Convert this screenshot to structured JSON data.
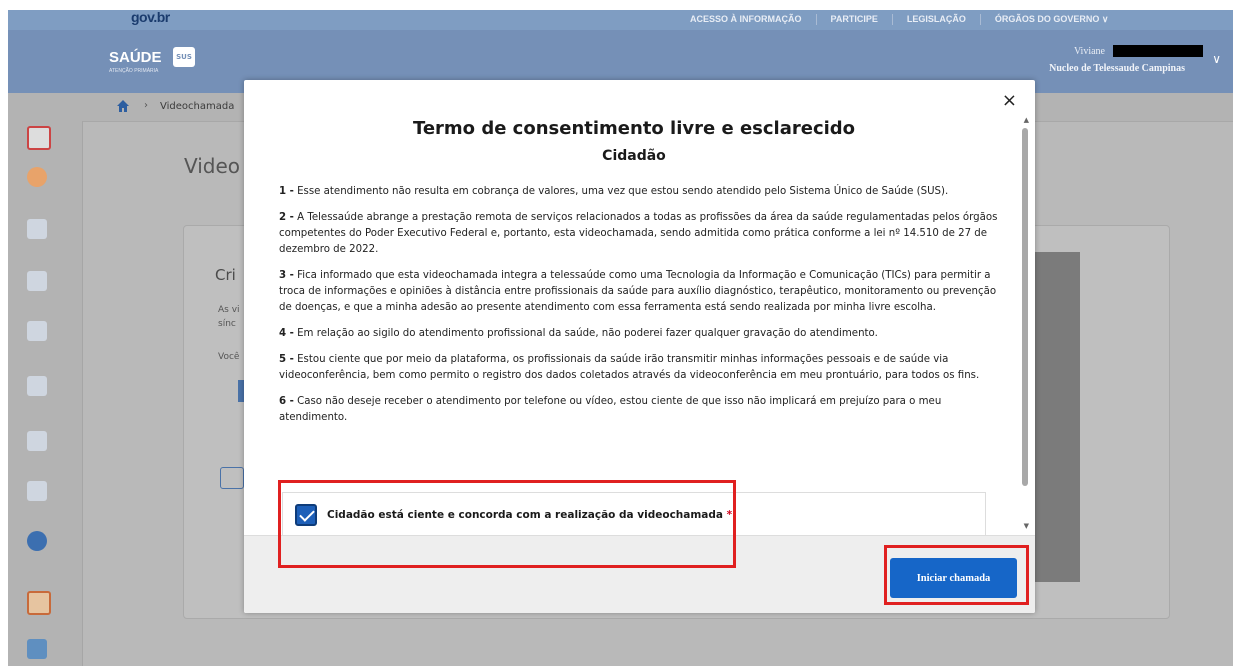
{
  "gov": {
    "logo": "gov.br",
    "links": [
      "ACESSO À INFORMAÇÃO",
      "PARTICIPE",
      "LEGISLAÇÃO",
      "ÓRGÃOS DO GOVERNO"
    ]
  },
  "app": {
    "logo": "SAÚDE",
    "logo_sub": "ATENÇÃO PRIMÁRIA",
    "logo_badge": "SUS",
    "user_name": "Viviane",
    "user_org": "Nucleo de Telessaude Campinas"
  },
  "breadcrumb": {
    "current": "Videochamada"
  },
  "background": {
    "title": "Video",
    "card_heading": "Cri",
    "card_text1": "As vi",
    "card_text2": "sínc",
    "card_text3": "Você"
  },
  "modal": {
    "title": "Termo de consentimento livre e esclarecido",
    "subtitle": "Cidadão",
    "items": [
      {
        "num": "1 -",
        "text": "Esse atendimento não resulta em cobrança de valores, uma vez que estou sendo atendido pelo Sistema Único de Saúde (SUS)."
      },
      {
        "num": "2 -",
        "text": "A Telessaúde abrange a prestação remota de serviços relacionados a todas as profissões da área da saúde regulamentadas pelos órgãos competentes do Poder Executivo Federal e, portanto, esta videochamada, sendo admitida como prática conforme a lei nº 14.510 de 27 de dezembro de 2022."
      },
      {
        "num": "3 -",
        "text": "Fica informado que esta videochamada integra a telessaúde como uma Tecnologia da Informação e Comunicação (TICs) para permitir a troca de informações e opiniões à distância entre profissionais da saúde para auxílio diagnóstico, terapêutico, monitoramento ou prevenção de doenças, e que a minha adesão ao presente atendimento com essa ferramenta está sendo realizada por minha livre escolha."
      },
      {
        "num": "4 -",
        "text": "Em relação ao sigilo do atendimento profissional da saúde, não poderei fazer qualquer gravação do atendimento."
      },
      {
        "num": "5 -",
        "text": "Estou ciente que por meio da plataforma, os profissionais da saúde irão transmitir minhas informações pessoais e de saúde via videoconferência, bem como permito o registro dos dados coletados através da videoconferência em meu prontuário, para todos os fins."
      },
      {
        "num": "6 -",
        "text": "Caso não deseje receber o atendimento por telefone ou vídeo, estou ciente de que isso não implicará em prejuízo para o meu atendimento."
      }
    ],
    "checkbox_label": "Cidadão está ciente e concorda com a realização da videochamada",
    "checkbox_required": "*",
    "close_label": "×",
    "button_label": "Iniciar chamada"
  },
  "colors": {
    "primary": "#1666c8",
    "highlight": "#e02020",
    "header": "#7590b7"
  }
}
